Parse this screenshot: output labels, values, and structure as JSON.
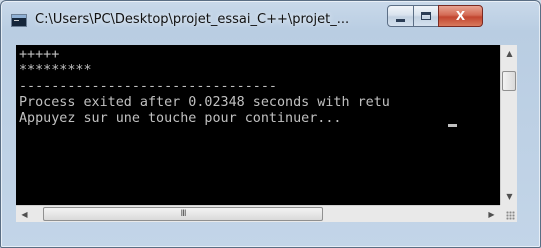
{
  "window": {
    "title": "C:\\Users\\PC\\Desktop\\projet_essai_C++\\projet_...",
    "buttons": {
      "minimize": "minimize",
      "maximize": "maximize",
      "close": "X"
    }
  },
  "console": {
    "lines": [
      "+++++",
      "*********",
      "--------------------------------",
      "Process exited after 0.02348 seconds with retu",
      "Appuyez sur une touche pour continuer... "
    ],
    "colors": {
      "background": "#000000",
      "text": "#c0c0c0"
    }
  },
  "scrollbars": {
    "up_arrow": "▲",
    "down_arrow": "▼",
    "left_arrow": "◀",
    "right_arrow": "▶",
    "h_thumb_grip": "III"
  }
}
